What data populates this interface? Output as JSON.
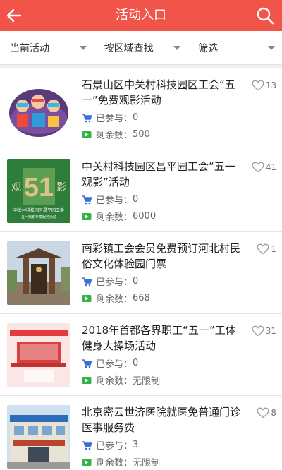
{
  "header": {
    "title": "活动入口"
  },
  "filters": [
    {
      "label": "当前活动"
    },
    {
      "label": "按区域查找"
    },
    {
      "label": "筛选"
    }
  ],
  "list_labels": {
    "joined_prefix": "已参与：",
    "remaining_prefix": "剩余数："
  },
  "items": [
    {
      "title": "石景山区中关村科技园区工会“五一”免费观影活动",
      "likes": "13",
      "joined": "0",
      "remaining": "500"
    },
    {
      "title": "中关村科技园区昌平园工会“五一观影”活动",
      "likes": "41",
      "joined": "0",
      "remaining": "6000",
      "thumb_texts": [
        "观",
        "影",
        "中关村科技园区昌平园工会",
        "五一观影专享服务活动"
      ]
    },
    {
      "title": "南彩镇工会会员免费预订河北村民俗文化体验园门票",
      "likes": "1",
      "joined": "0",
      "remaining": "668"
    },
    {
      "title": "2018年首都各界职工“五一”工体健身大操场活动",
      "likes": "31",
      "joined": "0",
      "remaining": "无限制"
    },
    {
      "title": "北京密云世济医院就医免普通门诊医事服务费",
      "likes": "8",
      "joined": "3",
      "remaining": "无限制"
    }
  ],
  "colors": {
    "header": "#f15448",
    "cart_icon": "#3b6fd6",
    "ticket_icon": "#35b24a",
    "heart_icon": "#999999"
  },
  "icons": {
    "back": "arrow-left-icon",
    "search": "search-icon",
    "like": "heart-icon",
    "joined": "cart-icon",
    "remaining": "ticket-icon"
  }
}
